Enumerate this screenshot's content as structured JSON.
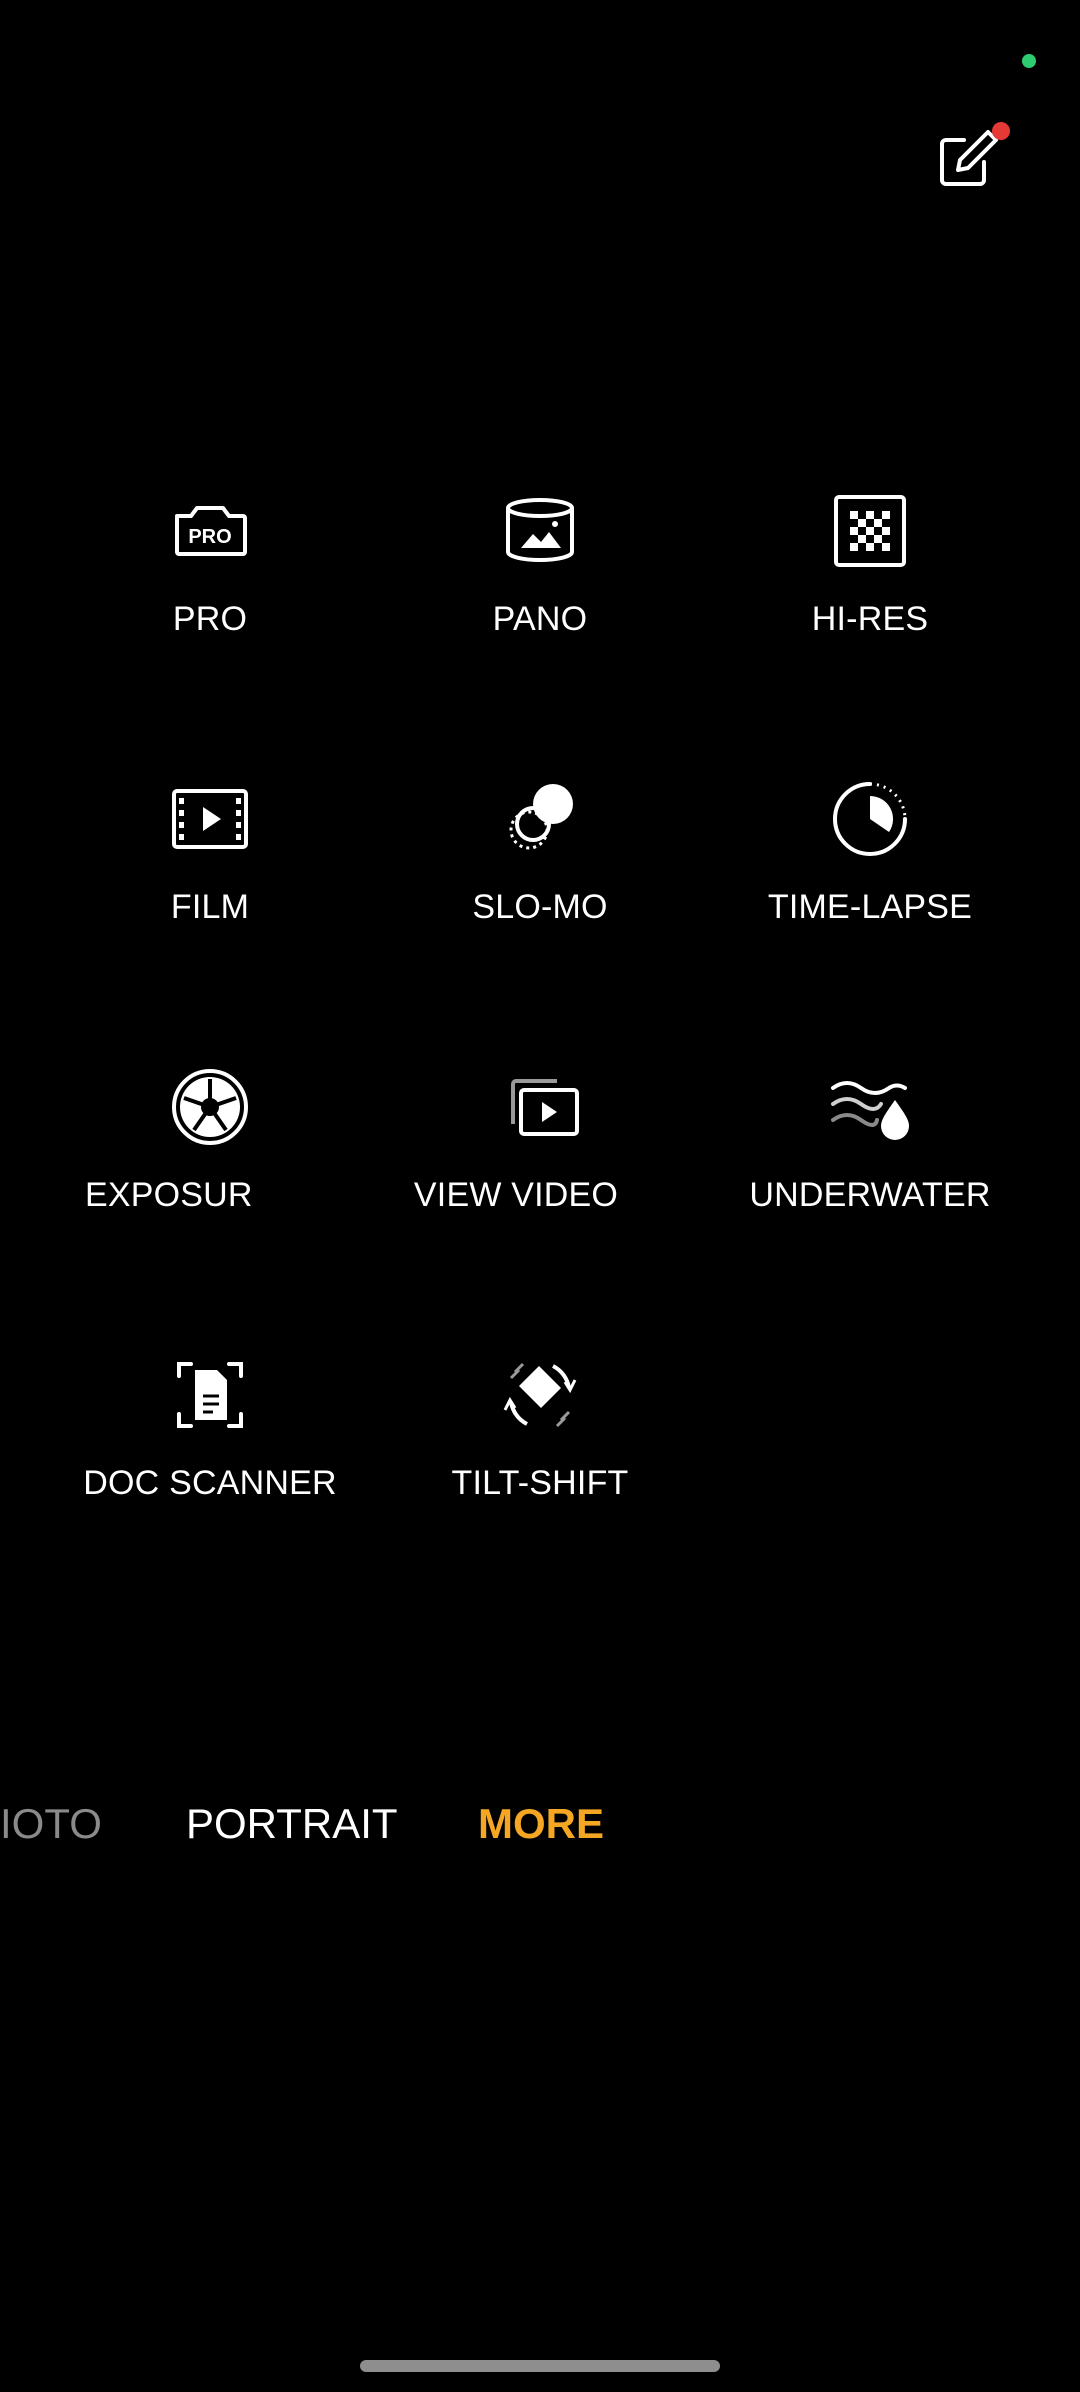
{
  "modes": [
    {
      "id": "pro",
      "label": "PRO",
      "icon": "pro-camera-icon",
      "icon_text": "PRO"
    },
    {
      "id": "pano",
      "label": "PANO",
      "icon": "panorama-icon"
    },
    {
      "id": "hi-res",
      "label": "HI-RES",
      "icon": "hi-res-grid-icon"
    },
    {
      "id": "film",
      "label": "FILM",
      "icon": "film-icon"
    },
    {
      "id": "slo-mo",
      "label": "SLO-MO",
      "icon": "slow-motion-icon"
    },
    {
      "id": "time-lapse",
      "label": "TIME-LAPSE",
      "icon": "time-lapse-icon"
    },
    {
      "id": "exposure",
      "label": "EXPOSURE",
      "icon": "aperture-icon"
    },
    {
      "id": "view-video",
      "label": "VIEW VIDEO",
      "icon": "video-playback-icon"
    },
    {
      "id": "underwater",
      "label": "UNDERWATER",
      "icon": "underwater-icon"
    },
    {
      "id": "doc-scanner",
      "label": "DOC SCANNER",
      "icon": "document-scanner-icon"
    },
    {
      "id": "tilt-shift",
      "label": "TILT-SHIFT",
      "icon": "tilt-shift-icon"
    }
  ],
  "bottom_tabs": [
    {
      "label": "IOTO",
      "state": "partial"
    },
    {
      "label": "PORTRAIT",
      "state": "normal"
    },
    {
      "label": "MORE",
      "state": "active"
    }
  ],
  "colors": {
    "background": "#000000",
    "active_tab": "#f5a623",
    "status_dot": "#2ecc71",
    "badge": "#e53935"
  }
}
